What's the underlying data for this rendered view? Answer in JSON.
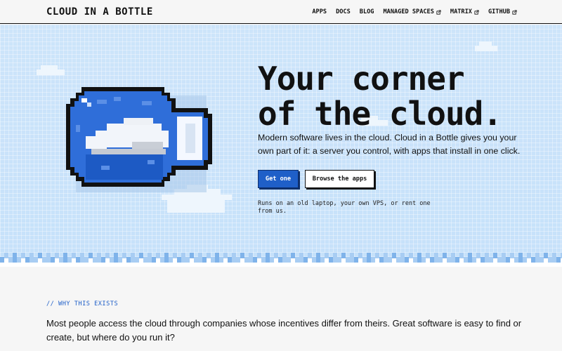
{
  "header": {
    "brand": "CLOUD IN A BOTTLE",
    "nav": [
      {
        "label": "APPS",
        "external": false
      },
      {
        "label": "DOCS",
        "external": false
      },
      {
        "label": "BLOG",
        "external": false
      },
      {
        "label": "MANAGED SPACES",
        "external": true
      },
      {
        "label": "MATRIX",
        "external": true
      },
      {
        "label": "GITHUB",
        "external": true
      }
    ]
  },
  "hero": {
    "title_line1": "Your corner",
    "title_line2": "of the cloud.",
    "lead": "Modern software lives in the cloud. Cloud in a Bottle gives you your own part of it: a server you control, with apps that install in one click.",
    "primary_button": "Get one",
    "secondary_button": "Browse the apps",
    "note": "Runs on an old laptop, your own VPS, or rent one from us."
  },
  "section": {
    "eyebrow": "// WHY THIS EXISTS",
    "text": "Most people access the cloud through companies whose incentives differ from theirs. Great software is easy to find or create, but where do you run it?"
  },
  "colors": {
    "accent": "#1f5fc8",
    "hero_bg": "#cfe6fb",
    "page_bg": "#f6f6f6",
    "ink": "#111111"
  },
  "icons": {
    "external": "external-link-icon",
    "illustration": "bottle-cloud-illustration"
  }
}
